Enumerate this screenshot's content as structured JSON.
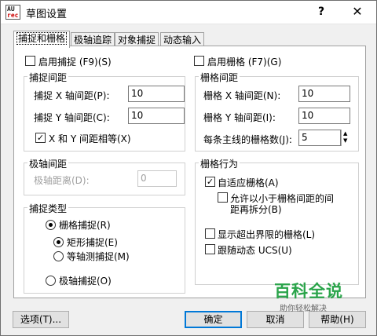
{
  "window": {
    "title": "草图设置",
    "help": "?",
    "close": "✕"
  },
  "app_icon": {
    "line1": "AU",
    "line2": "rec"
  },
  "tabs": [
    "捕捉和栅格",
    "极轴追踪",
    "对象捕捉",
    "动态输入"
  ],
  "snap": {
    "enable_label": "启用捕捉 (F9)(S)",
    "enabled": false,
    "spacing_legend": "捕捉间距",
    "x_label": "捕捉 X 轴间距(P):",
    "x_value": "10",
    "y_label": "捕捉 Y 轴间距(C):",
    "y_value": "10",
    "equal_label": "X 和 Y 间距相等(X)",
    "equal_checked": true
  },
  "polar": {
    "legend": "极轴间距",
    "distance_label": "极轴距离(D):",
    "distance_value": "0"
  },
  "snap_type": {
    "legend": "捕捉类型",
    "grid_snap": "栅格捕捉(R)",
    "rect_snap": "矩形捕捉(E)",
    "iso_snap": "等轴测捕捉(M)",
    "polar_snap": "极轴捕捉(O)"
  },
  "grid": {
    "enable_label": "启用栅格 (F7)(G)",
    "enabled": false,
    "spacing_legend": "栅格间距",
    "x_label": "栅格 X 轴间距(N):",
    "x_value": "10",
    "y_label": "栅格 Y 轴间距(I):",
    "y_value": "10",
    "major_label": "每条主线的栅格数(J):",
    "major_value": "5"
  },
  "grid_behavior": {
    "legend": "栅格行为",
    "adaptive": "自适应栅格(A)",
    "subdivide_1": "允许以小于栅格间距的间",
    "subdivide_2": "距再拆分(B)",
    "beyond": "显示超出界限的栅格(L)",
    "follow_ucs": "跟随动态 UCS(U)"
  },
  "buttons": {
    "options": "选项(T)...",
    "ok": "确定",
    "cancel": "取消",
    "help": "帮助(H)"
  },
  "watermark": {
    "title": "百科全说",
    "subtitle": "助你轻松解决"
  }
}
